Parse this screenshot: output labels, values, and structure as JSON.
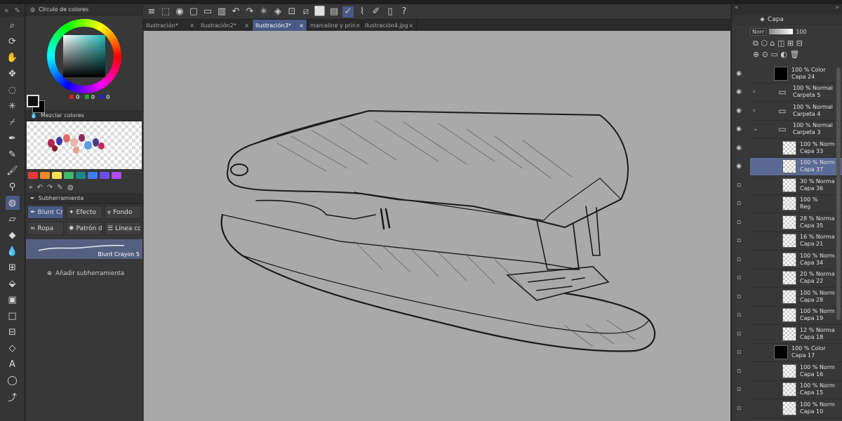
{
  "title_strip": "…",
  "toolbar_left": {
    "tools": [
      "magnifier-icon",
      "rotate-view-icon",
      "hand-icon",
      "move-icon",
      "lasso-icon",
      "magic-wand-icon",
      "eyedropper-icon",
      "pen-icon",
      "pencil-icon",
      "brush-icon",
      "airbrush-icon",
      "blend-icon",
      "eraser-icon",
      "fill-icon",
      "water-drop-icon",
      "grid-icon",
      "fill-bucket-icon",
      "gradient-icon",
      "rectangle-icon",
      "ruler-icon",
      "vector-icon",
      "text-icon",
      "balloon-icon",
      "line-icon"
    ]
  },
  "color_wheel": {
    "title": "Círculo de colores",
    "r": "0",
    "g": "0",
    "b": "0"
  },
  "mix": {
    "title": "Mezclar colores"
  },
  "palette_colors": [
    "#e23b3b",
    "#f08a24",
    "#f4e34d",
    "#41b86b",
    "#1c8a8a",
    "#3b7ef0",
    "#6d4df0",
    "#b14df0"
  ],
  "subtool": {
    "title": "Subherramienta",
    "row1": [
      "Blunt Cr",
      "Efecto",
      "Fondo"
    ],
    "row2": [
      "Ropa",
      "Patrón d",
      "Línea co"
    ],
    "brush_name": "Blunt Crayon 5",
    "add_label": "Añadir subherramienta"
  },
  "tabs": [
    "Ilustración*",
    "Ilustración2*",
    "Ilustración3*",
    "marceline y prin",
    "Ilustración4.jpg"
  ],
  "right": {
    "tab": "Capa",
    "blend": "Norr",
    "opacity": "100"
  },
  "layers": [
    {
      "line1": "100 % Color",
      "line2": "Capa 24",
      "kind": "black",
      "eye": true
    },
    {
      "line1": "100 % Normal",
      "line2": "Carpeta 5",
      "kind": "folder",
      "eye": true
    },
    {
      "line1": "100 % Normal",
      "line2": "Carpeta 4",
      "kind": "folder",
      "eye": true
    },
    {
      "line1": "100 % Normal",
      "line2": "Carpeta 3",
      "kind": "folder",
      "eye": true
    },
    {
      "line1": "100 % Norm",
      "line2": "Capa 33",
      "kind": "checker",
      "eye": true
    },
    {
      "line1": "100 % Norm",
      "line2": "Capa 37",
      "kind": "checker",
      "eye": true,
      "sel": true
    },
    {
      "line1": "30 % Norma",
      "line2": "Capa 36",
      "kind": "checker"
    },
    {
      "line1": "100 %",
      "line2": "Reg",
      "kind": "checker"
    },
    {
      "line1": "28 % Norma",
      "line2": "Capa 35",
      "kind": "checker"
    },
    {
      "line1": "16 % Norma",
      "line2": "Capa 21",
      "kind": "checker"
    },
    {
      "line1": "100 % Norm",
      "line2": "Capa 34",
      "kind": "checker"
    },
    {
      "line1": "20 % Norma",
      "line2": "Capa 22",
      "kind": "checker"
    },
    {
      "line1": "100 % Norm",
      "line2": "Capa 28",
      "kind": "checker"
    },
    {
      "line1": "100 % Norm",
      "line2": "Capa 19",
      "kind": "checker"
    },
    {
      "line1": "12 % Norma",
      "line2": "Capa 18",
      "kind": "checker"
    },
    {
      "line1": "100 % Color",
      "line2": "Capa 17",
      "kind": "black"
    },
    {
      "line1": "100 % Norm",
      "line2": "Capa 16",
      "kind": "checker"
    },
    {
      "line1": "100 % Norm",
      "line2": "Capa 15",
      "kind": "checker"
    },
    {
      "line1": "100 % Norm",
      "line2": "Capa 10",
      "kind": "checker"
    }
  ]
}
